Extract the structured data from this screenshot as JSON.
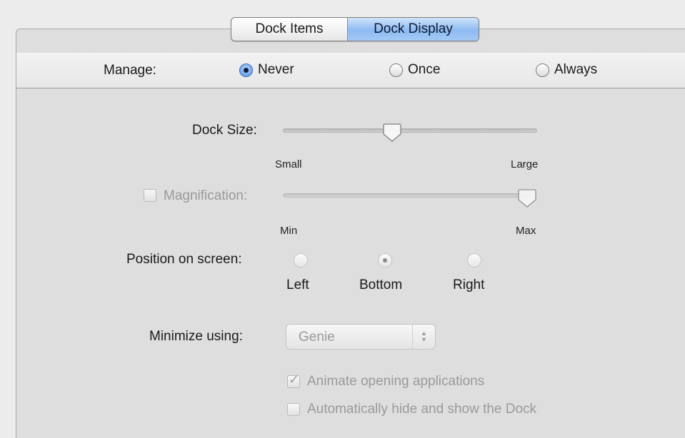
{
  "tabs": {
    "items_label": "Dock Items",
    "display_label": "Dock Display",
    "selected": "Dock Display"
  },
  "manage": {
    "label": "Manage:",
    "options": [
      "Never",
      "Once",
      "Always"
    ],
    "selected": "Never"
  },
  "dock_size": {
    "label": "Dock Size:",
    "min_label": "Small",
    "max_label": "Large",
    "value_fraction": 0.42
  },
  "magnification": {
    "label": "Magnification:",
    "enabled": false,
    "min_label": "Min",
    "max_label": "Max",
    "value_fraction": 1.0
  },
  "position": {
    "label": "Position on screen:",
    "options": [
      "Left",
      "Bottom",
      "Right"
    ],
    "selected": "Bottom"
  },
  "minimize": {
    "label": "Minimize using:",
    "value": "Genie"
  },
  "animate": {
    "label": "Animate opening applications",
    "checked": true
  },
  "autohide": {
    "label": "Automatically hide and show the Dock",
    "checked": false
  }
}
